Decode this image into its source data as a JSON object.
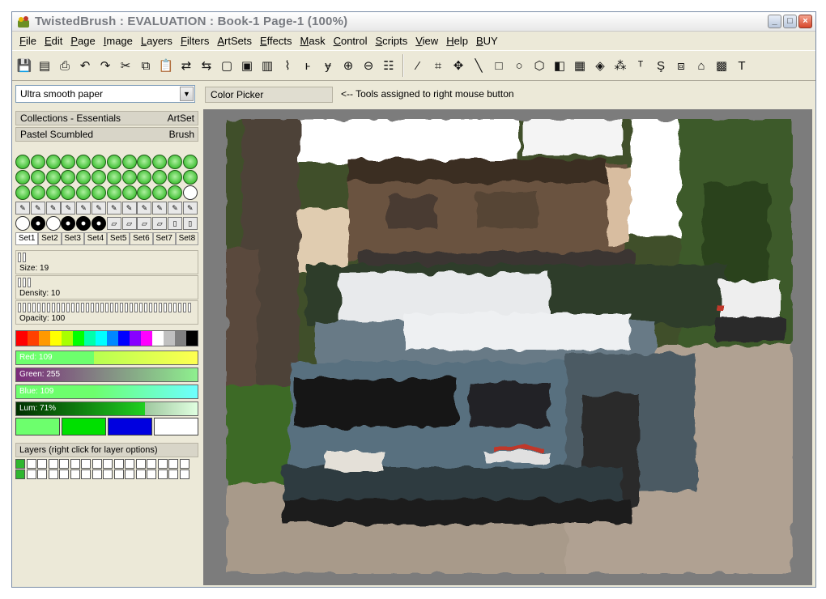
{
  "window": {
    "title": "TwistedBrush : EVALUATION : Book-1 Page-1 (100%)",
    "minimize": "_",
    "maximize": "□",
    "close": "×"
  },
  "menu": [
    {
      "first": "F",
      "rest": "ile"
    },
    {
      "first": "E",
      "rest": "dit"
    },
    {
      "first": "P",
      "rest": "age"
    },
    {
      "first": "I",
      "rest": "mage"
    },
    {
      "first": "L",
      "rest": "ayers"
    },
    {
      "first": "F",
      "rest": "ilters"
    },
    {
      "first": "A",
      "rest": "rtSets"
    },
    {
      "first": "E",
      "rest": "ffects"
    },
    {
      "first": "M",
      "rest": "ask"
    },
    {
      "first": "C",
      "rest": "ontrol"
    },
    {
      "first": "S",
      "rest": "cripts"
    },
    {
      "first": "V",
      "rest": "iew"
    },
    {
      "first": "H",
      "rest": "elp"
    },
    {
      "first": "B",
      "rest": "UY"
    }
  ],
  "left_panel": {
    "paper_select": "Ultra smooth paper",
    "collection_label": "Collections - Essentials",
    "collection_button": "ArtSet",
    "brush_name": "Pastel Scumbled",
    "brush_button": "Brush",
    "sets": [
      "Set1",
      "Set2",
      "Set3",
      "Set4",
      "Set5",
      "Set6",
      "Set7",
      "Set8"
    ],
    "size_label": "Size: 19",
    "density_label": "Density: 10",
    "opacity_label": "Opacity: 100",
    "red_label": "Red: 109",
    "green_label": "Green: 255",
    "blue_label": "Blue: 109",
    "lum_label": "Lum: 71%",
    "layers_label": "Layers (right click for layer options)"
  },
  "levels": {
    "red": 0.43,
    "green": 1.0,
    "blue": 0.43,
    "lum": 0.71
  },
  "colors": {
    "current": "#6dff6d",
    "swatch_1": "#6dff6d",
    "swatch_2": "#00e000",
    "swatch_3": "#0000e0",
    "swatch_4": "#ffffff"
  },
  "tool_bar_info": {
    "right_tool": "Color Picker",
    "hint": "<-- Tools assigned to right mouse button"
  }
}
